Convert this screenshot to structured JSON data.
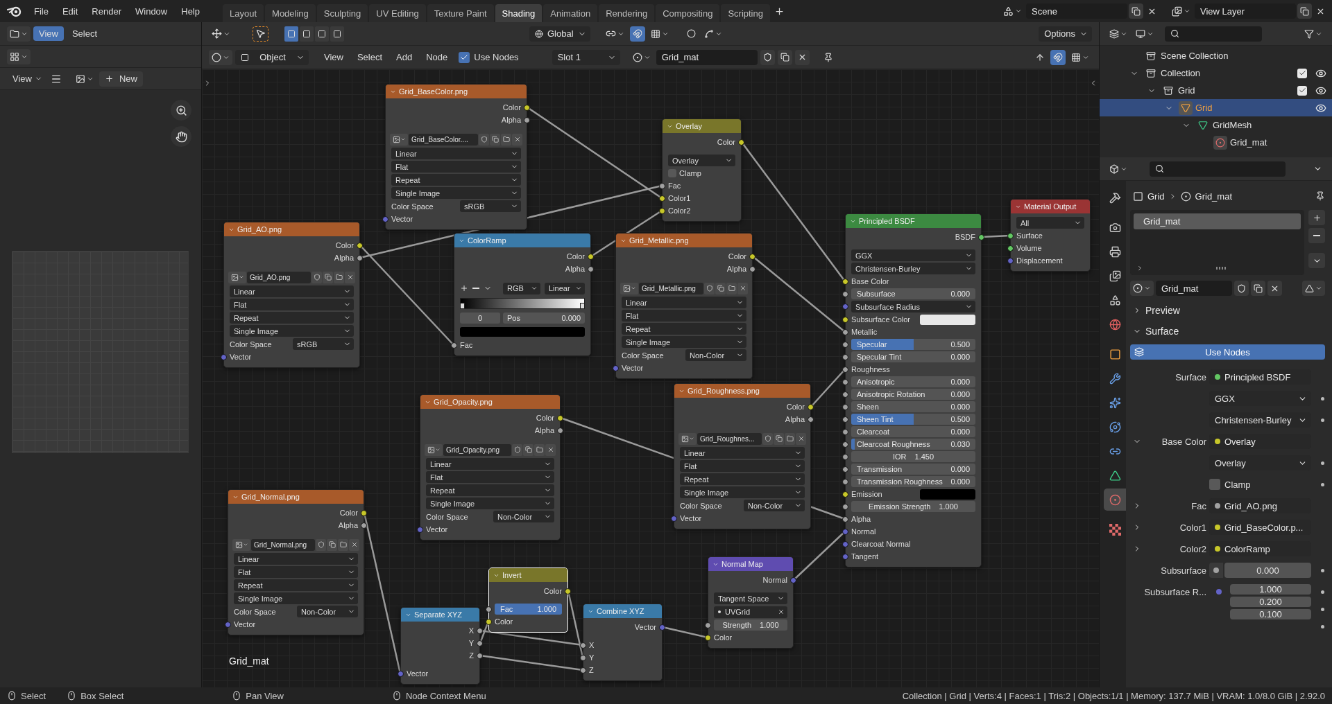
{
  "menu": [
    "File",
    "Edit",
    "Render",
    "Window",
    "Help"
  ],
  "workspaces": [
    {
      "label": "Layout",
      "selected": false
    },
    {
      "label": "Modeling",
      "selected": false
    },
    {
      "label": "Sculpting",
      "selected": false
    },
    {
      "label": "UV Editing",
      "selected": false
    },
    {
      "label": "Texture Paint",
      "selected": false
    },
    {
      "label": "Shading",
      "selected": true
    },
    {
      "label": "Animation",
      "selected": false
    },
    {
      "label": "Rendering",
      "selected": false
    },
    {
      "label": "Compositing",
      "selected": false
    },
    {
      "label": "Scripting",
      "selected": false
    }
  ],
  "scene": "Scene",
  "view_layer": "View Layer",
  "left_panel": {
    "header_menus": [
      {
        "label": "View",
        "selected": true
      },
      {
        "label": "Select",
        "selected": false
      }
    ],
    "image_menu": "View",
    "new_button": "New"
  },
  "node_editor": {
    "select_modes": [
      {
        "selected": true
      },
      {
        "selected": false
      },
      {
        "selected": false
      },
      {
        "selected": false
      }
    ],
    "orientation": "Global",
    "transform_snap": true,
    "options": "Options",
    "mode": "Object",
    "menus": [
      "View",
      "Select",
      "Add",
      "Node"
    ],
    "use_nodes": {
      "label": "Use Nodes",
      "checked": true
    },
    "slot": "Slot 1",
    "material": "Grid_mat",
    "node_snap": true,
    "nodes": [
      {
        "title": "Grid_BaseColor.png",
        "kind": "texture",
        "selected": false,
        "rows": [
          {
            "kind": "output",
            "label": "Color",
            "socket": {
              "kind": "color"
            }
          },
          {
            "kind": "output",
            "label": "Alpha",
            "socket": {
              "kind": "value"
            }
          },
          {
            "kind": "image",
            "value": "Grid_BaseColor...."
          },
          {
            "kind": "select",
            "value": "Linear"
          },
          {
            "kind": "select",
            "value": "Flat"
          },
          {
            "kind": "select",
            "value": "Repeat"
          },
          {
            "kind": "select",
            "value": "Single Image"
          },
          {
            "kind": "labeled_select",
            "label": "Color Space",
            "value": "sRGB"
          },
          {
            "kind": "input",
            "label": "Vector",
            "socket": {
              "kind": "vector"
            }
          }
        ]
      },
      {
        "title": "Overlay",
        "kind": "color",
        "selected": false,
        "rows": [
          {
            "kind": "output",
            "label": "Color",
            "socket": {
              "kind": "color"
            }
          },
          {
            "kind": "select",
            "value": "Overlay"
          },
          {
            "kind": "checkbox",
            "label": "Clamp",
            "checked": false
          },
          {
            "kind": "input",
            "label": "Fac",
            "socket": {
              "kind": "value"
            }
          },
          {
            "kind": "input",
            "label": "Color1",
            "socket": {
              "kind": "color"
            }
          },
          {
            "kind": "input",
            "label": "Color2",
            "socket": {
              "kind": "color"
            }
          }
        ]
      },
      {
        "title": "Grid_AO.png",
        "kind": "texture",
        "selected": false,
        "rows": [
          {
            "kind": "output",
            "label": "Color",
            "socket": {
              "kind": "color"
            }
          },
          {
            "kind": "output",
            "label": "Alpha",
            "socket": {
              "kind": "value"
            }
          },
          {
            "kind": "image",
            "value": "Grid_AO.png"
          },
          {
            "kind": "select",
            "value": "Linear"
          },
          {
            "kind": "select",
            "value": "Flat"
          },
          {
            "kind": "select",
            "value": "Repeat"
          },
          {
            "kind": "select",
            "value": "Single Image"
          },
          {
            "kind": "labeled_select",
            "label": "Color Space",
            "value": "sRGB"
          },
          {
            "kind": "input",
            "label": "Vector",
            "socket": {
              "kind": "vector"
            }
          }
        ]
      },
      {
        "title": "ColorRamp",
        "kind": "converter",
        "selected": false,
        "rows": [
          {
            "kind": "output",
            "label": "Color",
            "socket": {
              "kind": "color"
            }
          },
          {
            "kind": "output",
            "label": "Alpha",
            "socket": {
              "kind": "value"
            }
          },
          {
            "kind": "ramp_tools",
            "mode": "RGB",
            "interpolation": "Linear"
          },
          {
            "kind": "ramp_bar"
          },
          {
            "kind": "ramp_fields",
            "index": "0",
            "label": "Pos",
            "value": "0.000"
          },
          {
            "kind": "swatch_bar",
            "color": "#000000"
          },
          {
            "kind": "input",
            "label": "Fac",
            "socket": {
              "kind": "value"
            }
          }
        ]
      },
      {
        "title": "Grid_Metallic.png",
        "kind": "texture",
        "selected": false,
        "rows": [
          {
            "kind": "output",
            "label": "Color",
            "socket": {
              "kind": "color"
            }
          },
          {
            "kind": "output",
            "label": "Alpha",
            "socket": {
              "kind": "value"
            }
          },
          {
            "kind": "image",
            "value": "Grid_Metallic.png"
          },
          {
            "kind": "select",
            "value": "Linear"
          },
          {
            "kind": "select",
            "value": "Flat"
          },
          {
            "kind": "select",
            "value": "Repeat"
          },
          {
            "kind": "select",
            "value": "Single Image"
          },
          {
            "kind": "labeled_select",
            "label": "Color Space",
            "value": "Non-Color"
          },
          {
            "kind": "input",
            "label": "Vector",
            "socket": {
              "kind": "vector"
            }
          }
        ]
      },
      {
        "title": "Principled BSDF",
        "kind": "shader",
        "selected": false,
        "rows": [
          {
            "kind": "output",
            "label": "BSDF",
            "socket": {
              "kind": "shader"
            }
          },
          {
            "kind": "select",
            "value": "GGX"
          },
          {
            "kind": "select",
            "value": "Christensen-Burley"
          },
          {
            "kind": "input",
            "label": "Base Color",
            "socket": {
              "kind": "color"
            }
          },
          {
            "kind": "slider",
            "label": "Subsurface",
            "value": "0.000",
            "level": 0,
            "socket": {
              "kind": "value"
            }
          },
          {
            "kind": "select",
            "value": "Subsurface Radius",
            "socket": {
              "kind": "vector"
            }
          },
          {
            "kind": "swatch",
            "label": "Subsurface Color",
            "color": "#e8e8e8",
            "socket": {
              "kind": "color"
            }
          },
          {
            "kind": "input",
            "label": "Metallic",
            "socket": {
              "kind": "value"
            }
          },
          {
            "kind": "slider",
            "label": "Specular",
            "value": "0.500",
            "level": 0.5,
            "socket": {
              "kind": "value"
            }
          },
          {
            "kind": "slider",
            "label": "Specular Tint",
            "value": "0.000",
            "level": 0,
            "socket": {
              "kind": "value"
            }
          },
          {
            "kind": "input",
            "label": "Roughness",
            "socket": {
              "kind": "value"
            }
          },
          {
            "kind": "slider",
            "label": "Anisotropic",
            "value": "0.000",
            "level": 0,
            "socket": {
              "kind": "value"
            }
          },
          {
            "kind": "slider",
            "label": "Anisotropic Rotation",
            "value": "0.000",
            "level": 0,
            "socket": {
              "kind": "value"
            }
          },
          {
            "kind": "slider",
            "label": "Sheen",
            "value": "0.000",
            "level": 0,
            "socket": {
              "kind": "value"
            }
          },
          {
            "kind": "slider",
            "label": "Sheen Tint",
            "value": "0.500",
            "level": 0.5,
            "socket": {
              "kind": "value"
            }
          },
          {
            "kind": "slider",
            "label": "Clearcoat",
            "value": "0.000",
            "level": 0,
            "socket": {
              "kind": "value"
            }
          },
          {
            "kind": "slider",
            "label": "Clearcoat Roughness",
            "value": "0.030",
            "level": 0.03,
            "socket": {
              "kind": "value"
            }
          },
          {
            "kind": "number",
            "label": "IOR",
            "value": "1.450",
            "socket": {
              "kind": "value"
            }
          },
          {
            "kind": "slider",
            "label": "Transmission",
            "value": "0.000",
            "level": 0,
            "socket": {
              "kind": "value"
            }
          },
          {
            "kind": "slider",
            "label": "Transmission Roughness",
            "value": "0.000",
            "level": 0,
            "socket": {
              "kind": "value"
            }
          },
          {
            "kind": "swatch",
            "label": "Emission",
            "color": "#000000",
            "socket": {
              "kind": "color"
            }
          },
          {
            "kind": "number",
            "label": "Emission Strength",
            "value": "1.000",
            "socket": {
              "kind": "value"
            }
          },
          {
            "kind": "input",
            "label": "Alpha",
            "socket": {
              "kind": "value"
            }
          },
          {
            "kind": "input",
            "label": "Normal",
            "socket": {
              "kind": "vector"
            }
          },
          {
            "kind": "input",
            "label": "Clearcoat Normal",
            "socket": {
              "kind": "vector"
            }
          },
          {
            "kind": "input",
            "label": "Tangent",
            "socket": {
              "kind": "vector"
            }
          }
        ]
      },
      {
        "title": "Material Output",
        "kind": "output",
        "selected": false,
        "rows": [
          {
            "kind": "select",
            "value": "All"
          },
          {
            "kind": "input",
            "label": "Surface",
            "socket": {
              "kind": "shader"
            }
          },
          {
            "kind": "input",
            "label": "Volume",
            "socket": {
              "kind": "shader"
            }
          },
          {
            "kind": "input",
            "label": "Displacement",
            "socket": {
              "kind": "vector"
            }
          }
        ]
      },
      {
        "title": "Grid_Opacity.png",
        "kind": "texture",
        "selected": false,
        "rows": [
          {
            "kind": "output",
            "label": "Color",
            "socket": {
              "kind": "color"
            }
          },
          {
            "kind": "output",
            "label": "Alpha",
            "socket": {
              "kind": "value"
            }
          },
          {
            "kind": "image",
            "value": "Grid_Opacity.png"
          },
          {
            "kind": "select",
            "value": "Linear"
          },
          {
            "kind": "select",
            "value": "Flat"
          },
          {
            "kind": "select",
            "value": "Repeat"
          },
          {
            "kind": "select",
            "value": "Single Image"
          },
          {
            "kind": "labeled_select",
            "label": "Color Space",
            "value": "Non-Color"
          },
          {
            "kind": "input",
            "label": "Vector",
            "socket": {
              "kind": "vector"
            }
          }
        ]
      },
      {
        "title": "Grid_Roughness.png",
        "kind": "texture",
        "selected": false,
        "rows": [
          {
            "kind": "output",
            "label": "Color",
            "socket": {
              "kind": "color"
            }
          },
          {
            "kind": "output",
            "label": "Alpha",
            "socket": {
              "kind": "value"
            }
          },
          {
            "kind": "image",
            "value": "Grid_Roughnes..."
          },
          {
            "kind": "select",
            "value": "Linear"
          },
          {
            "kind": "select",
            "value": "Flat"
          },
          {
            "kind": "select",
            "value": "Repeat"
          },
          {
            "kind": "select",
            "value": "Single Image"
          },
          {
            "kind": "labeled_select",
            "label": "Color Space",
            "value": "Non-Color"
          },
          {
            "kind": "input",
            "label": "Vector",
            "socket": {
              "kind": "vector"
            }
          }
        ]
      },
      {
        "title": "Grid_Normal.png",
        "kind": "texture",
        "selected": false,
        "rows": [
          {
            "kind": "output",
            "label": "Color",
            "socket": {
              "kind": "color"
            }
          },
          {
            "kind": "output",
            "label": "Alpha",
            "socket": {
              "kind": "value"
            }
          },
          {
            "kind": "image",
            "value": "Grid_Normal.png"
          },
          {
            "kind": "select",
            "value": "Linear"
          },
          {
            "kind": "select",
            "value": "Flat"
          },
          {
            "kind": "select",
            "value": "Repeat"
          },
          {
            "kind": "select",
            "value": "Single Image"
          },
          {
            "kind": "labeled_select",
            "label": "Color Space",
            "value": "Non-Color"
          },
          {
            "kind": "input",
            "label": "Vector",
            "socket": {
              "kind": "vector"
            }
          }
        ]
      },
      {
        "title": "Invert",
        "kind": "color",
        "selected": true,
        "rows": [
          {
            "kind": "output",
            "label": "Color",
            "socket": {
              "kind": "color"
            }
          },
          {
            "kind": "slider",
            "label": "Fac",
            "value": "1.000",
            "level": 1,
            "socket": {
              "kind": "value"
            }
          },
          {
            "kind": "input",
            "label": "Color",
            "socket": {
              "kind": "color"
            }
          }
        ]
      },
      {
        "title": "Separate XYZ",
        "kind": "converter",
        "selected": false,
        "rows": [
          {
            "kind": "output",
            "label": "X",
            "socket": {
              "kind": "value"
            }
          },
          {
            "kind": "output",
            "label": "Y",
            "socket": {
              "kind": "value"
            }
          },
          {
            "kind": "output",
            "label": "Z",
            "socket": {
              "kind": "value"
            }
          },
          {
            "kind": "input",
            "label": "Vector",
            "socket": {
              "kind": "vector"
            }
          }
        ]
      },
      {
        "title": "Combine XYZ",
        "kind": "converter",
        "selected": false,
        "rows": [
          {
            "kind": "output",
            "label": "Vector",
            "socket": {
              "kind": "vector"
            }
          },
          {
            "kind": "input",
            "label": "X",
            "socket": {
              "kind": "value"
            }
          },
          {
            "kind": "input",
            "label": "Y",
            "socket": {
              "kind": "value"
            }
          },
          {
            "kind": "input",
            "label": "Z",
            "socket": {
              "kind": "value"
            }
          }
        ]
      },
      {
        "title": "Normal Map",
        "kind": "vector",
        "selected": false,
        "rows": [
          {
            "kind": "output",
            "label": "Normal",
            "socket": {
              "kind": "vector"
            }
          },
          {
            "kind": "select",
            "value": "Tangent Space"
          },
          {
            "kind": "uv_map",
            "value": "UVGrid"
          },
          {
            "kind": "number",
            "label": "Strength",
            "value": "1.000",
            "socket": {
              "kind": "value"
            }
          },
          {
            "kind": "input",
            "label": "Color",
            "socket": {
              "kind": "color"
            }
          }
        ]
      }
    ],
    "material_label": "Grid_mat"
  },
  "outliner": {
    "root": {
      "label": "Scene Collection",
      "kind": "scene",
      "selected": false,
      "children": [
        {
          "label": "Collection",
          "kind": "collection",
          "expanded": true,
          "checked": true,
          "visible": true,
          "selected": false,
          "children": [
            {
              "label": "Grid",
              "kind": "collection",
              "expanded": true,
              "checked": true,
              "visible": true,
              "selected": false,
              "children": [
                {
                  "label": "Grid",
                  "kind": "object",
                  "expanded": true,
                  "visible": true,
                  "selected": true,
                  "children": [
                    {
                      "label": "GridMesh",
                      "kind": "mesh",
                      "expanded": true,
                      "selected": false,
                      "children": [
                        {
                          "label": "Grid_mat",
                          "kind": "material",
                          "selected": false
                        }
                      ]
                    }
                  ]
                }
              ]
            }
          ]
        }
      ]
    }
  },
  "properties": {
    "tabs": [
      {
        "kind": "tool",
        "selected": false
      },
      {
        "kind": "render",
        "selected": false
      },
      {
        "kind": "output",
        "selected": false
      },
      {
        "kind": "view_layer",
        "selected": false
      },
      {
        "kind": "scene",
        "selected": false
      },
      {
        "kind": "world",
        "selected": false
      },
      {
        "kind": "object",
        "selected": false
      },
      {
        "kind": "modifiers",
        "selected": false
      },
      {
        "kind": "particles",
        "selected": false
      },
      {
        "kind": "physics",
        "selected": false
      },
      {
        "kind": "constraints",
        "selected": false
      },
      {
        "kind": "data",
        "selected": false
      },
      {
        "kind": "material",
        "selected": true
      },
      {
        "kind": "texture",
        "selected": false
      }
    ],
    "breadcrumb": {
      "object": "Grid",
      "material": "Grid_mat"
    },
    "slots": [
      {
        "label": "Grid_mat",
        "selected": true
      }
    ],
    "material": "Grid_mat",
    "panels": [
      {
        "label": "Preview",
        "expanded": false
      },
      {
        "label": "Surface",
        "expanded": true
      }
    ],
    "use_nodes": "Use Nodes",
    "rows": [
      {
        "kind": "link",
        "label": "Surface",
        "value": "Principled BSDF",
        "socket": {
          "kind": "shader"
        }
      },
      {
        "kind": "select",
        "value": "GGX"
      },
      {
        "kind": "select",
        "value": "Christensen-Burley"
      },
      {
        "kind": "link",
        "label": "Base Color",
        "value": "Overlay",
        "socket": {
          "kind": "color"
        },
        "expanded": true
      },
      {
        "kind": "select",
        "value": "Overlay"
      },
      {
        "kind": "checkbox",
        "label": "Clamp",
        "checked": false
      },
      {
        "kind": "link",
        "label": "Fac",
        "value": "Grid_AO.png",
        "socket": {
          "kind": "value"
        },
        "expanded": false
      },
      {
        "kind": "link",
        "label": "Color1",
        "value": "Grid_BaseColor.p...",
        "socket": {
          "kind": "color"
        },
        "expanded": false
      },
      {
        "kind": "link",
        "label": "Color2",
        "value": "ColorRamp",
        "socket": {
          "kind": "color"
        },
        "expanded": false
      },
      {
        "kind": "number",
        "label": "Subsurface",
        "value": "0.000",
        "socket": {
          "kind": "value"
        }
      },
      {
        "kind": "vector",
        "label": "Subsurface R...",
        "values": [
          "1.000",
          "0.200",
          "0.100"
        ],
        "socket": {
          "kind": "vector"
        }
      }
    ]
  },
  "status_bar": {
    "hints": [
      "Select",
      "Box Select",
      "Pan View",
      "Node Context Menu"
    ],
    "stats": "Collection | Grid | Verts:4 | Faces:1 | Tris:2 | Objects:1/1 | Memory: 137.7 MiB | VRAM: 1.0/8.0 GiB | 2.92.0"
  }
}
